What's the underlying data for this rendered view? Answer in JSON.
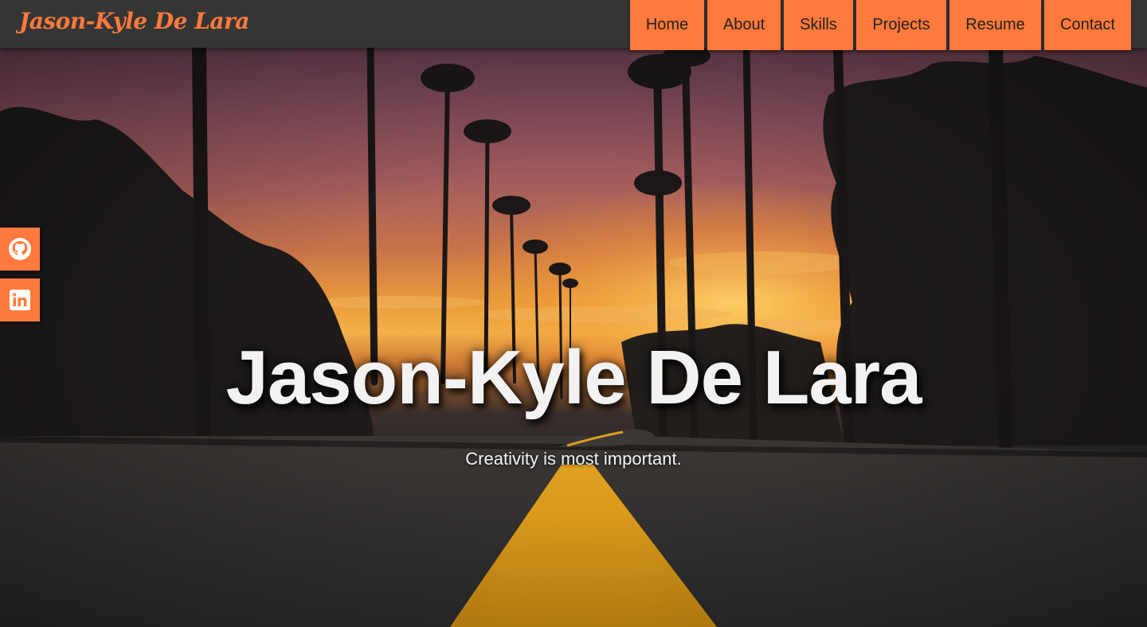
{
  "header": {
    "brand": "Jason-Kyle De Lara",
    "nav": [
      {
        "label": "Home"
      },
      {
        "label": "About"
      },
      {
        "label": "Skills"
      },
      {
        "label": "Projects"
      },
      {
        "label": "Resume"
      },
      {
        "label": "Contact"
      }
    ]
  },
  "social": [
    {
      "icon": "github-icon"
    },
    {
      "icon": "linkedin-icon"
    }
  ],
  "hero": {
    "title": "Jason-Kyle De Lara",
    "tagline": "Creativity is most important."
  },
  "colors": {
    "accent": "#ff7a3c",
    "navbar": "#353535",
    "hero_text": "#f2f2f2"
  }
}
